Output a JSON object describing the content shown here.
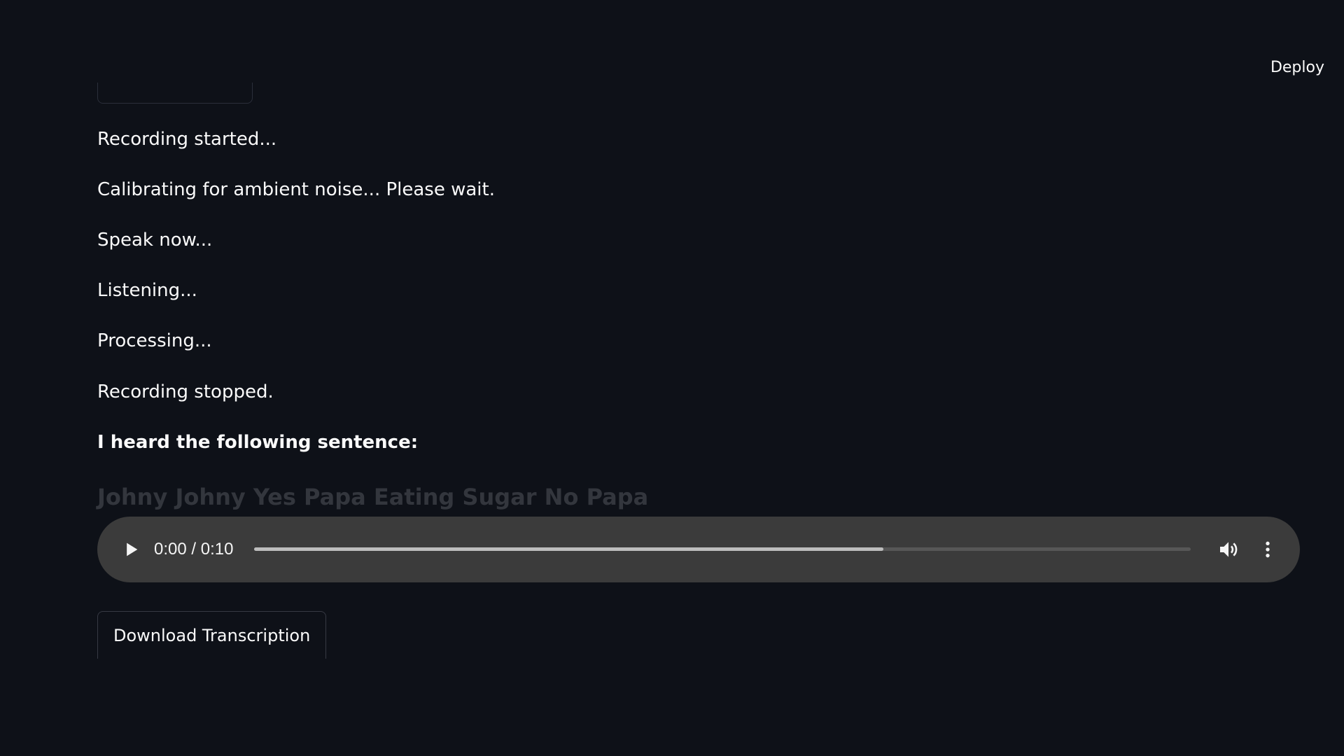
{
  "header": {
    "deploy_label": "Deploy"
  },
  "log": {
    "lines": [
      "Recording started...",
      "Calibrating for ambient noise... Please wait.",
      "Speak now...",
      "Listening...",
      "Processing...",
      "Recording stopped."
    ],
    "heard_label": "I heard the following sentence:",
    "transcript": "Johny Johny Yes Papa Eating Sugar No Papa"
  },
  "audio": {
    "time_display": "0:00 / 0:10",
    "buffered_fraction": 0.672,
    "icons": {
      "play": "play-icon",
      "volume": "volume-icon",
      "menu": "more-vertical-icon"
    }
  },
  "actions": {
    "download_label": "Download Transcription"
  },
  "colors": {
    "background": "#0e1118",
    "text": "#fafafa",
    "player_bg": "#3b3b3b",
    "transcript_text": "#33363d"
  }
}
